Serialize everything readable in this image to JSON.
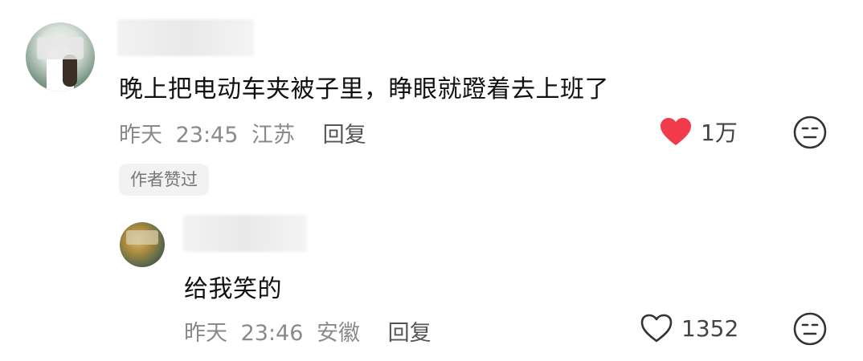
{
  "main_comment": {
    "text": "晚上把电动车夹被子里，睁眼就蹬着去上班了",
    "date": "昨天",
    "time": "23:45",
    "location": "江苏",
    "reply_label": "回复",
    "like_count": "1万",
    "liked": true,
    "author_liked_badge": "作者赞过",
    "icons": {
      "like": "heart-filled-icon",
      "emoji": "neutral-face-icon"
    }
  },
  "reply_comment": {
    "text": "给我笑的",
    "date": "昨天",
    "time": "23:46",
    "location": "安徽",
    "reply_label": "回复",
    "like_count": "1352",
    "liked": false,
    "icons": {
      "like": "heart-outline-icon",
      "emoji": "neutral-face-icon"
    }
  },
  "colors": {
    "like_active": "#f23b4a",
    "meta_gray": "#8a8a8a",
    "badge_bg": "#f2f2f2"
  }
}
